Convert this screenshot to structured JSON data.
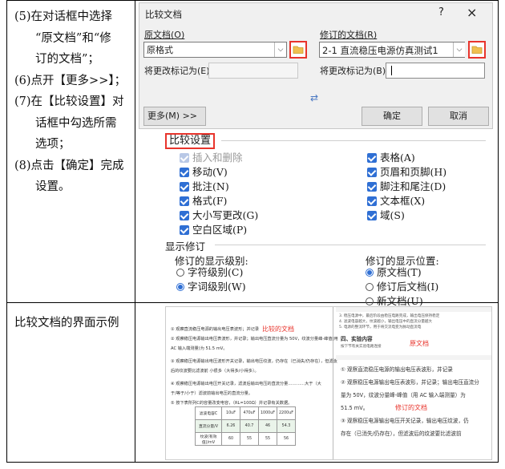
{
  "steps": [
    "(5)在对话框中选择",
    "“原文档”和“修",
    "订的文档”；",
    "(6)点开【更多>>】；",
    "(7)在【比较设置】对",
    "话框中勾选所需",
    "选项；",
    "(8)点击【确定】完成",
    "设置。"
  ],
  "example_label": "比较文档的界面示例",
  "dialog": {
    "title": "比较文档",
    "help": "?",
    "close": "×",
    "original_label": "原文档(O)",
    "original_value": "原格式",
    "revised_label": "修订的文档(R)",
    "revised_value": "2-1 直流稳压电源仿真测试1",
    "mark_label_left": "将更改标记为(E)",
    "mark_label_right": "将更改标记为(B)",
    "more_button": "更多(M) >>",
    "ok_button": "确定",
    "cancel_button": "取消",
    "swap_icon": "⇄"
  },
  "settings": {
    "title": "比较设置",
    "left_items": [
      "插入和删除",
      "移动(V)",
      "批注(N)",
      "格式(F)",
      "大小写更改(G)",
      "空白区域(P)"
    ],
    "right_items": [
      "表格(A)",
      "页眉和页脚(H)",
      "脚注和尾注(D)",
      "文本框(X)",
      "域(S)"
    ],
    "show_title": "显示修订",
    "level_label": "修订的显示级别:",
    "level_char": "字符级别(C)",
    "level_word": "字词级别(W)",
    "pos_label": "修订的显示位置:",
    "pos_original": "原文档(T)",
    "pos_revised": "修订后文档(I)",
    "pos_new": "新文档(U)"
  },
  "example": {
    "compared_label": "比较的文档",
    "original_label": "原文档",
    "revised_label": "修订的文档",
    "section": "四、实验内容",
    "table": [
      [
        "滤波电容C",
        "10uF",
        "470uF",
        "1000uF",
        "2200uF"
      ],
      [
        "直流分量/V",
        "6.26",
        "40.7",
        "46",
        "54.3"
      ],
      [
        "纹波(有效值)/mV",
        "60",
        "55",
        "55",
        "56"
      ]
    ]
  },
  "colors": {
    "accent_red": "#e8342c",
    "check_blue": "#2f6fd4"
  }
}
